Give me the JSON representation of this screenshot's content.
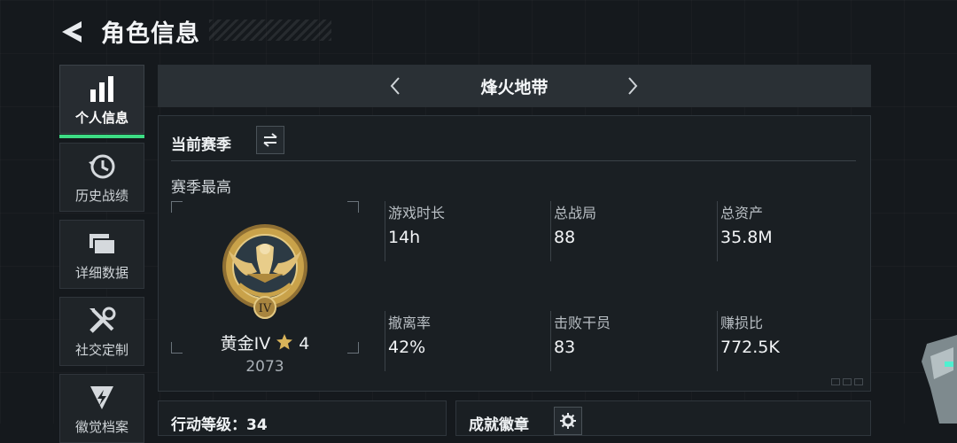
{
  "header": {
    "title": "角色信息"
  },
  "sidebar": {
    "items": [
      {
        "label": "个人信息",
        "icon": "bar-chart-icon",
        "active": true
      },
      {
        "label": "历史战绩",
        "icon": "history-clock-icon",
        "active": false
      },
      {
        "label": "详细数据",
        "icon": "folder-stack-icon",
        "active": false
      },
      {
        "label": "社交定制",
        "icon": "tools-icon",
        "active": false
      },
      {
        "label": "徽觉档案",
        "icon": "emblem-icon",
        "active": false
      }
    ]
  },
  "mode": {
    "name": "烽火地带"
  },
  "season": {
    "title": "当前赛季",
    "best_label": "赛季最高",
    "rank_name": "黄金IV",
    "rank_stars": "4",
    "rank_score": "2073",
    "badge_numeral": "IV"
  },
  "stats": [
    {
      "label": "游戏时长",
      "value": "14h"
    },
    {
      "label": "总战局",
      "value": "88"
    },
    {
      "label": "总资产",
      "value": "35.8M"
    },
    {
      "label": "撤离率",
      "value": "42%"
    },
    {
      "label": "击败干员",
      "value": "83"
    },
    {
      "label": "赚损比",
      "value": "772.5K"
    }
  ],
  "bottom": {
    "level_label": "行动等级：34",
    "achievements_label": "成就徽章"
  },
  "colors": {
    "accent": "#3ddc84",
    "gold": "#c9a24a"
  }
}
